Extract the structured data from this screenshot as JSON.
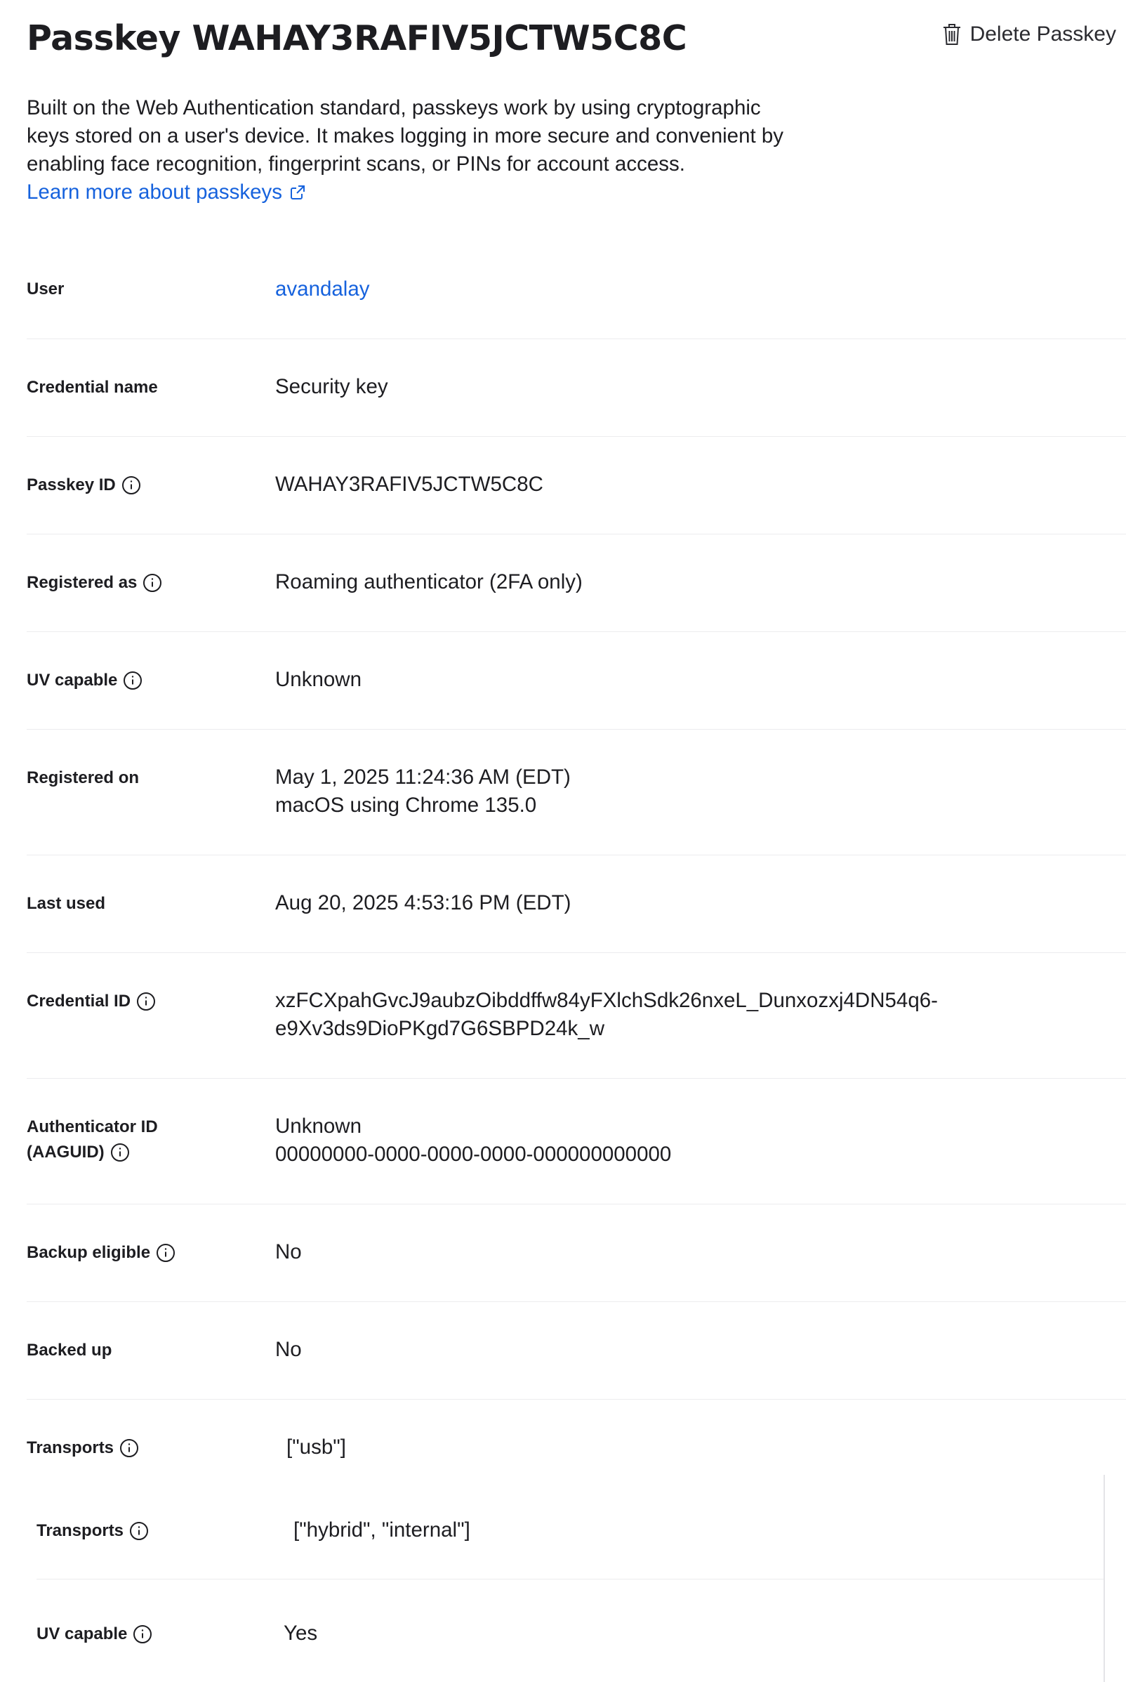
{
  "header": {
    "title": "Passkey WAHAY3RAFIV5JCTW5C8C",
    "delete_label": "Delete Passkey"
  },
  "intro": {
    "text": "Built on the Web Authentication standard, passkeys work by using cryptographic keys stored on a user's device. It makes logging in more secure and convenient by enabling face recognition, fingerprint scans, or PINs for account access.",
    "link_label": "Learn more about passkeys"
  },
  "details": {
    "user": {
      "label": "User",
      "value": "avandalay"
    },
    "credential_name": {
      "label": "Credential name",
      "value": "Security key"
    },
    "passkey_id": {
      "label": "Passkey ID",
      "value": "WAHAY3RAFIV5JCTW5C8C"
    },
    "registered_as": {
      "label": "Registered as",
      "value": "Roaming authenticator (2FA only)"
    },
    "uv_capable": {
      "label": "UV capable",
      "value": "Unknown"
    },
    "registered_on": {
      "label": "Registered on",
      "line1": "May 1, 2025 11:24:36 AM (EDT)",
      "line2": "macOS using Chrome 135.0"
    },
    "last_used": {
      "label": "Last used",
      "value": "Aug 20, 2025 4:53:16 PM (EDT)"
    },
    "credential_id": {
      "label": "Credential ID",
      "line1": "xzFCXpahGvcJ9aubzOibddffw84yFXlchSdk26nxeL_Dunxozxj4DN54q6-",
      "line2": "e9Xv3ds9DioPKgd7G6SBPD24k_w"
    },
    "aaguid": {
      "label_line1": "Authenticator ID",
      "label_line2": "(AAGUID)",
      "line1": "Unknown",
      "line2": "00000000-0000-0000-0000-000000000000"
    },
    "backup_eligible": {
      "label": "Backup eligible",
      "value": "No"
    },
    "backed_up": {
      "label": "Backed up",
      "value": "No"
    },
    "transports": {
      "label": "Transports",
      "value": "[\"usb\"]"
    }
  },
  "nested": {
    "transports": {
      "label": "Transports",
      "value": "[\"hybrid\", \"internal\"]"
    },
    "uv_capable": {
      "label": "UV capable",
      "value": "Yes"
    }
  }
}
